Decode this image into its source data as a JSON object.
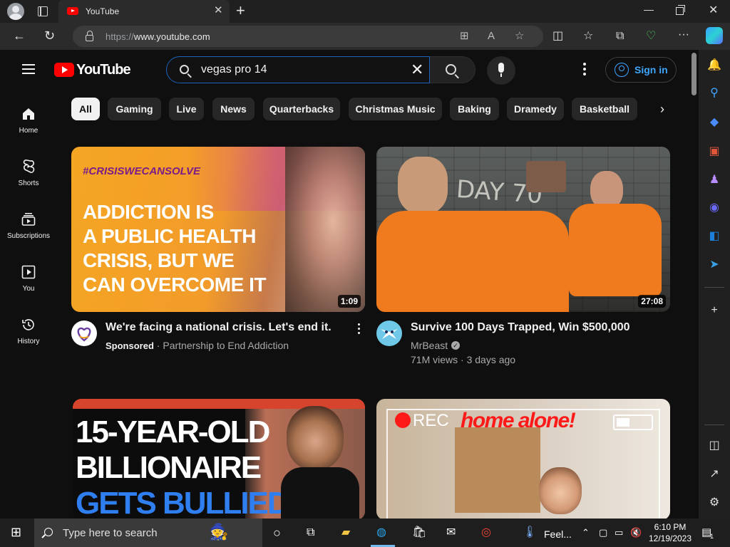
{
  "browser": {
    "tab_title": "YouTube",
    "url_protocol": "https://",
    "url_host": "www.youtube.com"
  },
  "youtube": {
    "logo_text": "YouTube",
    "search_query": "vegas pro 14",
    "signin_label": "Sign in",
    "left_nav": [
      {
        "label": "Home"
      },
      {
        "label": "Shorts"
      },
      {
        "label": "Subscriptions"
      },
      {
        "label": "You"
      },
      {
        "label": "History"
      }
    ],
    "chips": [
      "All",
      "Gaming",
      "Live",
      "News",
      "Quarterbacks",
      "Christmas Music",
      "Baking",
      "Dramedy",
      "Basketball"
    ],
    "videos": [
      {
        "title": "We're facing a national crisis. Let's end it.",
        "sponsored": "Sponsored",
        "channel": "Partnership to End Addiction",
        "duration": "1:09",
        "thumb_tag": "#CRISISWECANSOLVE",
        "thumb_line1": "ADDICTION IS",
        "thumb_line2": "A PUBLIC HEALTH",
        "thumb_line3": "CRISIS, BUT WE",
        "thumb_line4": "CAN OVERCOME IT"
      },
      {
        "title": "Survive 100 Days Trapped, Win $500,000",
        "channel": "MrBeast",
        "stats": "71M views · 3 days ago",
        "duration": "27:08",
        "thumb_text": "DAY 70"
      },
      {
        "thumb_line1": "15-YEAR-OLD",
        "thumb_line2": "BILLIONAIRE",
        "thumb_line3": "GETS BULLIED"
      },
      {
        "thumb_rec": "REC",
        "thumb_text": "home alone!"
      }
    ]
  },
  "taskbar": {
    "search_placeholder": "Type here to search",
    "weather": "Feel...",
    "time": "6:10 PM",
    "date": "12/19/2023",
    "notification_count": "1"
  },
  "colors": {
    "youtube_red": "#ff0000",
    "link_blue": "#3ea6ff",
    "page_bg": "#0f0f0f"
  }
}
